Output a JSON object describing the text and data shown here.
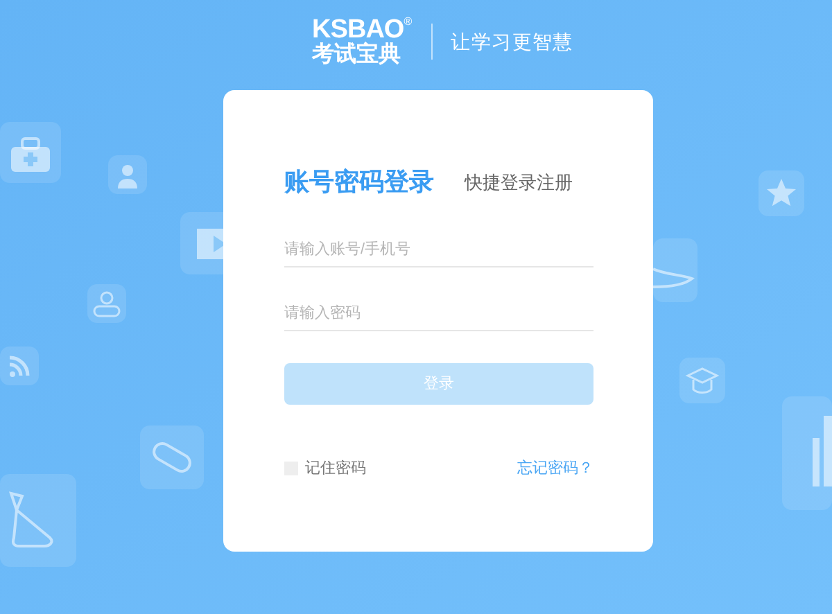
{
  "header": {
    "logo_text": "KSBAO",
    "logo_mark": "®",
    "logo_subtitle": "考试宝典",
    "slogan": "让学习更智慧"
  },
  "tabs": [
    {
      "label": "账号密码登录",
      "selected": true
    },
    {
      "label": "快捷登录注册",
      "selected": false
    }
  ],
  "fields": [
    {
      "placeholder": "请输入账号/手机号"
    },
    {
      "placeholder": "请输入密码"
    }
  ],
  "login_button": {
    "label": "登录",
    "disabled": true
  },
  "remember": {
    "label": "记住密码",
    "checked": false
  },
  "forgot_link": "忘记密码？"
}
